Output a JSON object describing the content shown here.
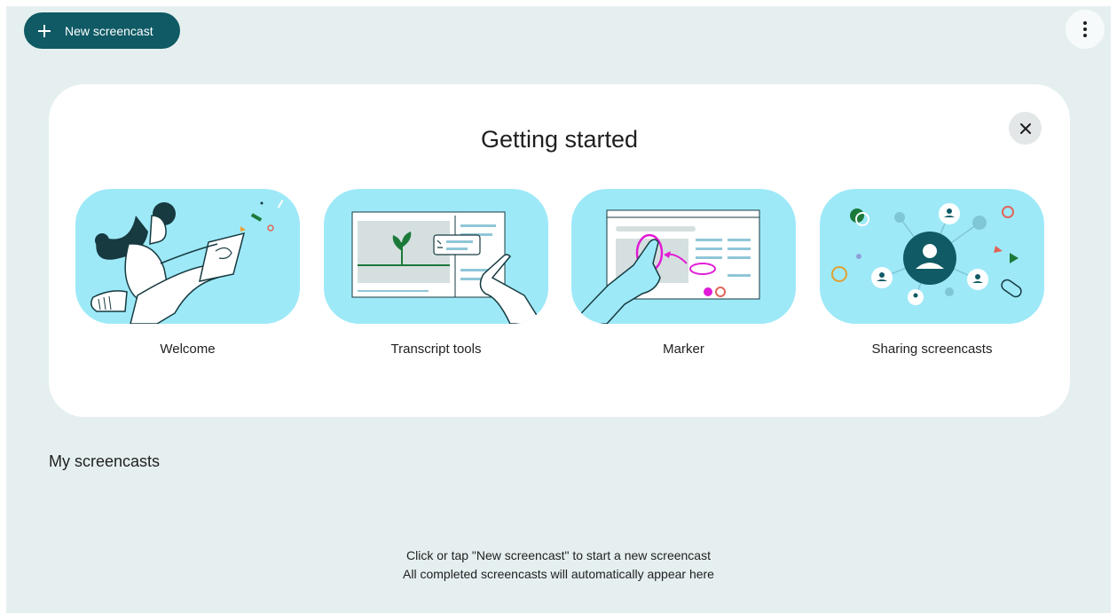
{
  "toolbar": {
    "new_label": "New screencast",
    "new_icon": "plus-icon",
    "more_icon": "more-vertical-icon"
  },
  "getting_started": {
    "title": "Getting started",
    "close_icon": "close-icon",
    "tiles": [
      {
        "label": "Welcome",
        "illustration": "person-with-laptop"
      },
      {
        "label": "Transcript tools",
        "illustration": "video-transcript-hand"
      },
      {
        "label": "Marker",
        "illustration": "hand-drawing-marker"
      },
      {
        "label": "Sharing screencasts",
        "illustration": "people-network"
      }
    ]
  },
  "my_screencasts": {
    "title": "My screencasts",
    "empty_line1": "Click or tap \"New screencast\" to start a new screencast",
    "empty_line2": "All completed screencasts will automatically appear here"
  },
  "colors": {
    "primary": "#0f5a64",
    "background": "#e5eff0",
    "tile": "#9ee9f8",
    "accent_pink": "#e21bd6"
  }
}
